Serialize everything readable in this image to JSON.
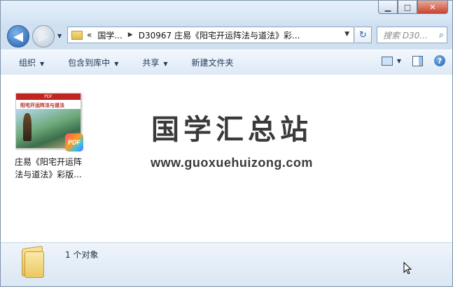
{
  "window": {
    "minimize_glyph": "▁",
    "maximize_glyph": "□",
    "close_glyph": "✕"
  },
  "nav": {
    "back_glyph": "◀",
    "forward_glyph": "▶",
    "history_glyph": "▼"
  },
  "address": {
    "overflow": "«",
    "crumbs": [
      "国学...",
      "D30967 庄易《阳宅开运阵法与道法》彩..."
    ],
    "separator": "▶",
    "dropdown_glyph": "▼",
    "refresh_glyph": "↻"
  },
  "search": {
    "placeholder": "搜索 D30...",
    "icon": "search-icon"
  },
  "toolbar": {
    "items": [
      {
        "label": "组织",
        "has_menu": true
      },
      {
        "label": "包含到库中",
        "has_menu": true
      },
      {
        "label": "共享",
        "has_menu": true
      },
      {
        "label": "新建文件夹",
        "has_menu": false
      }
    ],
    "menu_glyph": "▼",
    "help_glyph": "?"
  },
  "file": {
    "name_line1": "庄易《阳宅开运阵",
    "name_line2": "法与道法》彩版...",
    "thumb_header": "PDF",
    "thumb_title": "阳宅开运阵法与道法",
    "badge": "PDF"
  },
  "watermark": {
    "title": "国学汇总站",
    "url": "www.guoxuehuizong.com"
  },
  "details": {
    "count": "1 个对象"
  }
}
